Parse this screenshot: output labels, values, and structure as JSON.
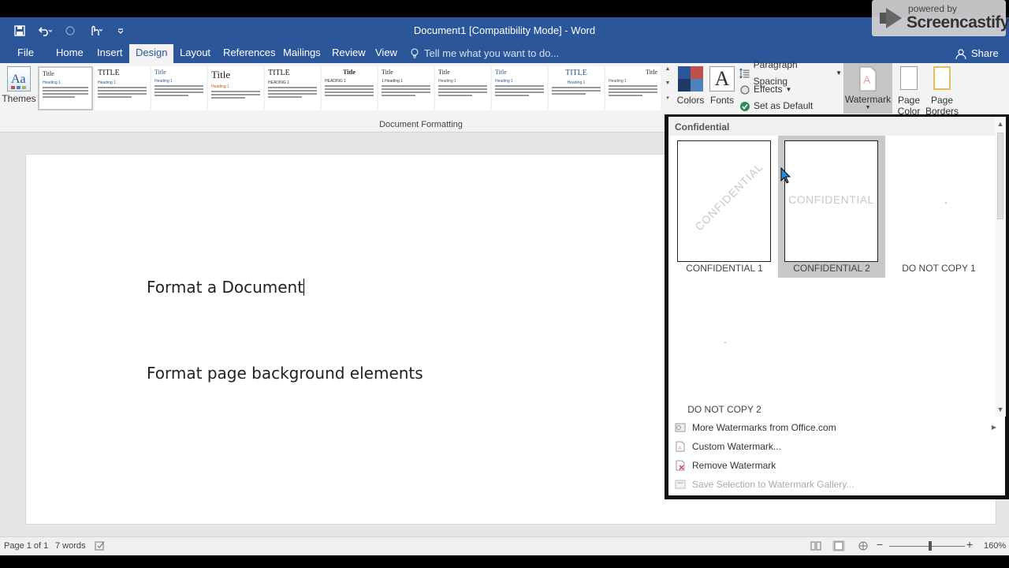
{
  "window": {
    "title": "Document1 [Compatibility Mode] - Word"
  },
  "branding": {
    "powered": "powered by",
    "name": "Screencastify"
  },
  "tabs": [
    {
      "label": "File"
    },
    {
      "label": "Home"
    },
    {
      "label": "Insert"
    },
    {
      "label": "Design"
    },
    {
      "label": "Layout"
    },
    {
      "label": "References"
    },
    {
      "label": "Mailings"
    },
    {
      "label": "Review"
    },
    {
      "label": "View"
    }
  ],
  "tell_me": "Tell me what you want to do...",
  "share": "Share",
  "ribbon": {
    "themes": "Themes",
    "group_label": "Document Formatting",
    "colors": "Colors",
    "fonts": "Fonts",
    "fonts_glyph": "A",
    "paragraph_spacing": "Paragraph Spacing",
    "effects": "Effects",
    "set_default": "Set as Default",
    "watermark": "Watermark",
    "page_color": "Page Color",
    "page_borders": "Page Borders",
    "style_thumbs": [
      {
        "title": "Title",
        "head": "Heading 1"
      },
      {
        "title": "TITLE",
        "head": "Heading 1"
      },
      {
        "title": "Title",
        "head": "Heading 1"
      },
      {
        "title": "Title",
        "head": "Heading 1"
      },
      {
        "title": "TITLE",
        "head": "HEADING 1"
      },
      {
        "title": "Title",
        "head": "HEADING 1"
      },
      {
        "title": "Title",
        "head": "1 Heading 1"
      },
      {
        "title": "Title",
        "head": "Heading 1"
      },
      {
        "title": "Title",
        "head": "Heading 1"
      },
      {
        "title": "TITLE",
        "head": "Heading 1"
      },
      {
        "title": "Title",
        "head": "Heading 1"
      }
    ]
  },
  "document": {
    "line1": "Format a Document",
    "line2": "Format page background elements"
  },
  "status": {
    "page": "Page 1 of 1",
    "words": "7 words",
    "zoom": "160%"
  },
  "watermark_panel": {
    "section": "Confidential",
    "items": [
      {
        "label": "CONFIDENTIAL 1",
        "text": "CONFIDENTIAL"
      },
      {
        "label": "CONFIDENTIAL 2",
        "text": "CONFIDENTIAL"
      },
      {
        "label": "DO NOT COPY 1",
        "text": ""
      },
      {
        "label": "DO NOT COPY 2",
        "text": ""
      }
    ],
    "menu": [
      {
        "label": "More Watermarks from Office.com"
      },
      {
        "label": "Custom Watermark..."
      },
      {
        "label": "Remove Watermark"
      },
      {
        "label": "Save Selection to Watermark Gallery..."
      }
    ]
  },
  "colors": {
    "accent": "#2b579a",
    "hover": "#c8c8c8"
  }
}
